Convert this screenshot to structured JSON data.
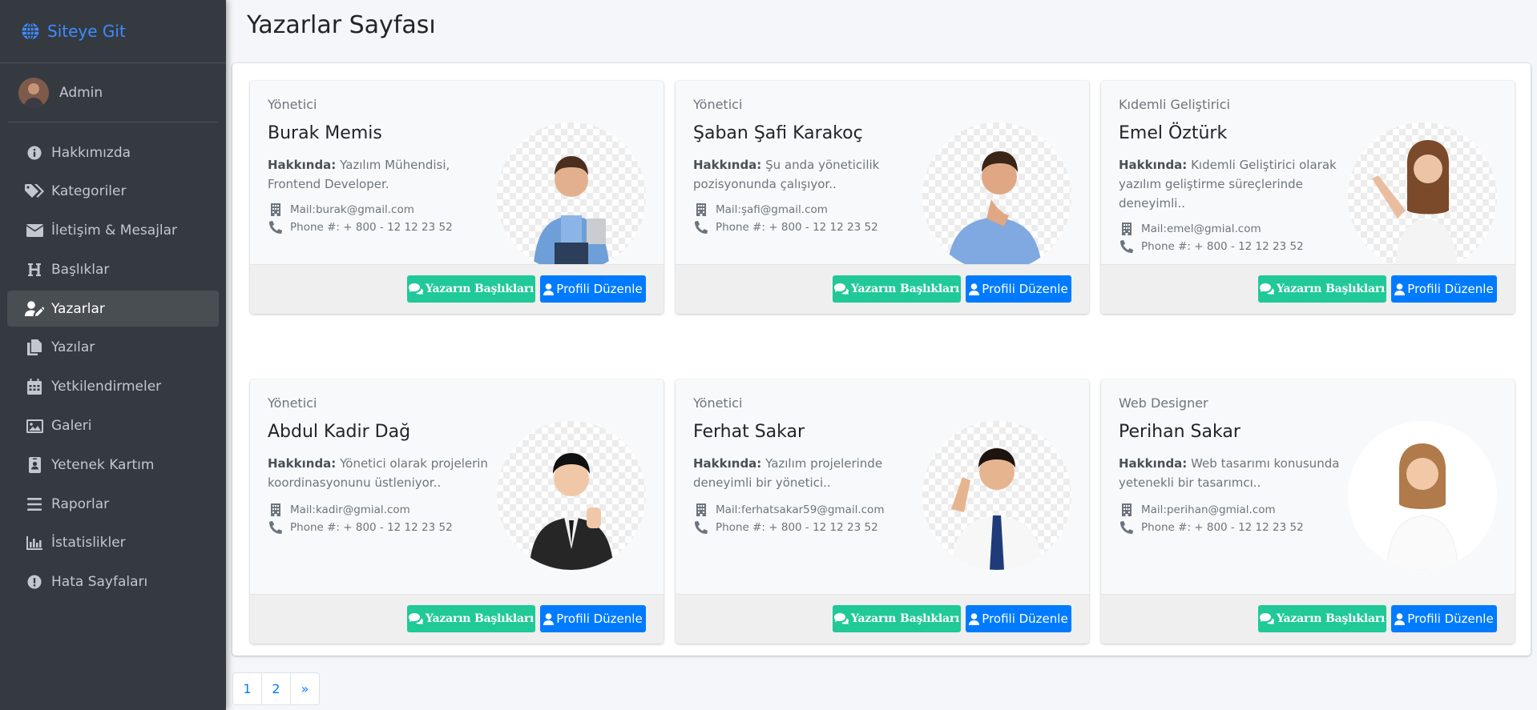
{
  "brand": {
    "label": "Siteye Git"
  },
  "user": {
    "name": "Admin"
  },
  "sidebar": {
    "items": [
      {
        "label": "Hakkımızda",
        "icon": "info-circle-icon"
      },
      {
        "label": "Kategoriler",
        "icon": "tags-icon"
      },
      {
        "label": "İletişim & Mesajlar",
        "icon": "envelope-icon"
      },
      {
        "label": "Başlıklar",
        "icon": "heading-icon"
      },
      {
        "label": "Yazarlar",
        "icon": "user-edit-icon",
        "active": true
      },
      {
        "label": "Yazılar",
        "icon": "copy-icon"
      },
      {
        "label": "Yetkilendirmeler",
        "icon": "calendar-icon"
      },
      {
        "label": "Galeri",
        "icon": "image-icon"
      },
      {
        "label": "Yetenek Kartım",
        "icon": "id-badge-icon"
      },
      {
        "label": "Raporlar",
        "icon": "bars-icon"
      },
      {
        "label": "İstatislikler",
        "icon": "chart-bar-icon"
      },
      {
        "label": "Hata Sayfaları",
        "icon": "exclamation-circle-icon"
      }
    ]
  },
  "page": {
    "title": "Yazarlar Sayfası"
  },
  "labels": {
    "about": "Hakkında:",
    "topics_button": "Yazarın Başlıkları",
    "edit_button": "Profili Düzenle"
  },
  "authors": [
    {
      "role": "Yönetici",
      "name": "Burak Memis",
      "about": "Yazılım Mühendisi, Frontend Developer.",
      "mail": "Mail:burak@gmail.com",
      "phone": "Phone #: + 800 - 12 12 23 52"
    },
    {
      "role": "Yönetici",
      "name": "Şaban Şafi Karakoç",
      "about": "Şu anda yöneticilik pozisyonunda çalışıyor..",
      "mail": "Mail:şafi@gmail.com",
      "phone": "Phone #: + 800 - 12 12 23 52"
    },
    {
      "role": "Kıdemli Geliştirici",
      "name": "Emel Öztürk",
      "about": "Kıdemli Geliştirici olarak yazılım geliştirme süreçlerinde deneyimli..",
      "mail": "Mail:emel@gmial.com",
      "phone": "Phone #: + 800 - 12 12 23 52"
    },
    {
      "role": "Yönetici",
      "name": "Abdul Kadir Dağ",
      "about": "Yönetici olarak projelerin koordinasyonunu üstleniyor..",
      "mail": "Mail:kadir@gmial.com",
      "phone": "Phone #: + 800 - 12 12 23 52"
    },
    {
      "role": "Yönetici",
      "name": "Ferhat Sakar",
      "about": "Yazılım projelerinde deneyimli bir yönetici..",
      "mail": "Mail:ferhatsakar59@gmail.com",
      "phone": "Phone #: + 800 - 12 12 23 52"
    },
    {
      "role": "Web Designer",
      "name": "Perihan Sakar",
      "about": "Web tasarımı konusunda yetenekli bir tasarımcı..",
      "mail": "Mail:perihan@gmial.com",
      "phone": "Phone #: + 800 - 12 12 23 52"
    }
  ],
  "pagination": {
    "pages": [
      "1",
      "2",
      "»"
    ]
  },
  "colors": {
    "sidebar": "#343a40",
    "brand": "#3f8bff",
    "green": "#20c997",
    "blue": "#007bff"
  }
}
